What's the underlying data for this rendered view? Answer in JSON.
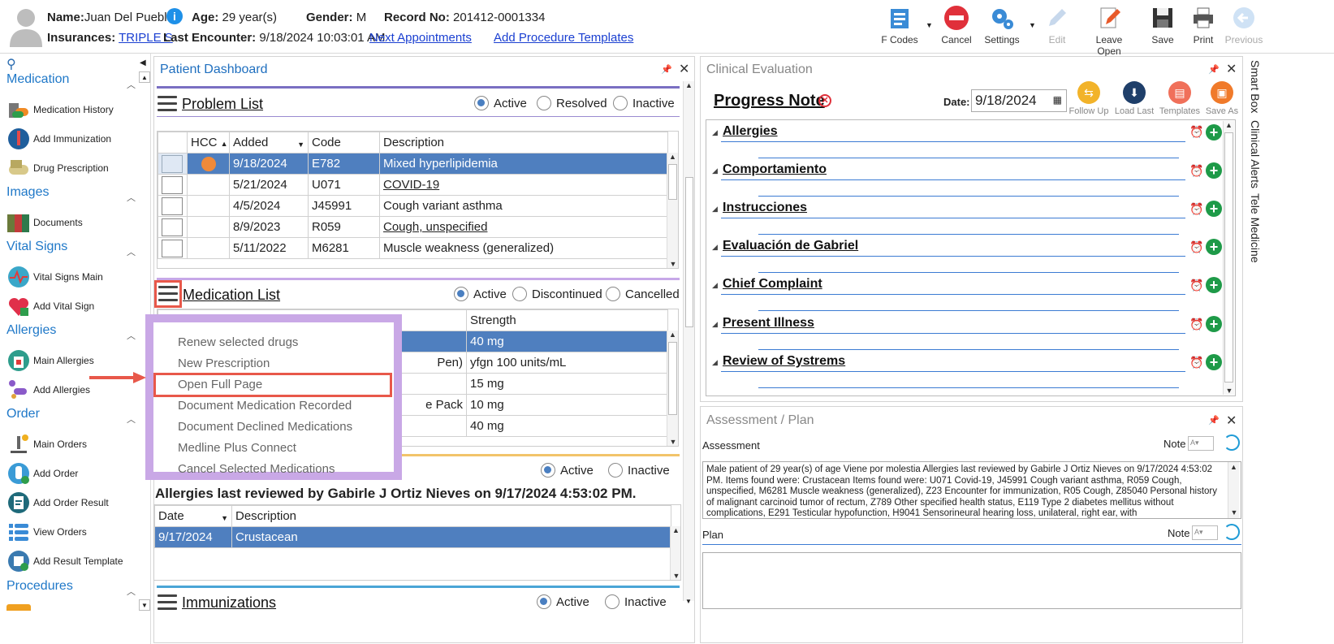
{
  "header": {
    "name_label": "Name:",
    "name": "Juan Del Pueblo",
    "age_label": "Age:",
    "age": "29 year(s)",
    "gender_label": "Gender:",
    "gender": "M",
    "record_label": "Record No:",
    "record": "201412-0001334",
    "insurances_label": "Insurances:",
    "insurance": "TRIPLE S",
    "last_encounter_label": "Last Encounter:",
    "last_encounter": "9/18/2024 10:03:01 AM",
    "next_appointments": "Next Appointments",
    "add_procedure_templates": "Add Procedure Templates"
  },
  "toolbar": {
    "fcodes": "F Codes",
    "cancel": "Cancel",
    "settings": "Settings",
    "edit": "Edit",
    "leave_open": "Leave Open",
    "save": "Save",
    "print": "Print",
    "previous": "Previous"
  },
  "sidebar": {
    "medication": "Medication",
    "medication_history": "Medication History",
    "add_immunization": "Add Immunization",
    "drug_prescription": "Drug Prescription",
    "images": "Images",
    "documents": "Documents",
    "vital_signs": "Vital Signs",
    "vital_signs_main": "Vital Signs Main",
    "add_vital_sign": "Add Vital Sign",
    "allergies": "Allergies",
    "main_allergies": "Main Allergies",
    "add_allergies": "Add Allergies",
    "order": "Order",
    "main_orders": "Main Orders",
    "add_order": "Add Order",
    "add_order_result": "Add Order Result",
    "view_orders": "View Orders",
    "add_result_template": "Add Result Template",
    "procedures": "Procedures"
  },
  "dashboard": {
    "title": "Patient Dashboard",
    "problem_list": {
      "title": "Problem List",
      "radios": [
        "Active",
        "Resolved",
        "Inactive"
      ],
      "columns": [
        "HCC",
        "Added",
        "Code",
        "Description"
      ],
      "rows": [
        {
          "added": "9/18/2024",
          "code": "E782",
          "desc": "Mixed hyperlipidemia"
        },
        {
          "added": "5/21/2024",
          "code": "U071",
          "desc": "COVID-19"
        },
        {
          "added": "4/5/2024",
          "code": "J45991",
          "desc": "Cough variant asthma"
        },
        {
          "added": "8/9/2023",
          "code": "R059",
          "desc": "Cough, unspecified"
        },
        {
          "added": "5/11/2022",
          "code": "M6281",
          "desc": "Muscle weakness (generalized)"
        }
      ]
    },
    "medication_list": {
      "title": "Medication List",
      "radios": [
        "Active",
        "Discontinued",
        "Cancelled"
      ],
      "strength_header": "Strength",
      "rows": [
        {
          "name": "",
          "strength": "40 mg"
        },
        {
          "name": "Pen)",
          "strength": "yfgn 100 units/mL"
        },
        {
          "name": "",
          "strength": "15 mg"
        },
        {
          "name": "e Pack",
          "strength": "10 mg"
        },
        {
          "name": "",
          "strength": "40 mg"
        }
      ]
    },
    "context_menu": {
      "items": [
        "Renew selected drugs",
        "New Prescription",
        "Open Full Page",
        "Document Medication Recorded",
        "Document Declined Medications",
        "Medline Plus Connect",
        "Cancel Selected Medications"
      ]
    },
    "allergies": {
      "radios": [
        "Active",
        "Inactive"
      ],
      "reviewed": "Allergies last reviewed by Gabirle J Ortiz Nieves on 9/17/2024 4:53:02 PM.",
      "columns": [
        "Date",
        "Description"
      ],
      "rows": [
        {
          "date": "9/17/2024",
          "desc": "Crustacean"
        }
      ]
    },
    "immunizations": {
      "title": "Immunizations",
      "radios": [
        "Active",
        "Inactive"
      ]
    }
  },
  "clinical": {
    "title": "Clinical Evaluation",
    "note_title": "Progress Note",
    "date_label": "Date:",
    "date": "9/18/2024",
    "actions": [
      "Follow Up",
      "Load Last",
      "Templates",
      "Save As"
    ],
    "sections": [
      "Allergies",
      "Comportamiento",
      "Instrucciones",
      "Evaluación de Gabriel",
      "Chief Complaint",
      "Present Illness",
      "Review of Systrems"
    ]
  },
  "assessment": {
    "title": "Assessment / Plan",
    "assessment_label": "Assessment",
    "note_label": "Note",
    "text": "Male patient of 29 year(s) of age Viene por molestia     Allergies last reviewed by Gabirle J Ortiz Nieves on 9/17/2024 4:53:02 PM.    Items found were:  Crustacean  Items found were:  U071 Covid-19, J45991 Cough variant asthma, R059 Cough, unspecified, M6281 Muscle weakness (generalized), Z23 Encounter for immunization, R05 Cough, Z85040 Personal history of malignant carcinoid tumor of rectum, Z789 Other specified health status, E119 Type 2 diabetes mellitus without complications, E291 Testicular hypofunction, H9041 Sensorineural hearing loss, unilateral, right ear, with",
    "plan_label": "Plan",
    "plan_note_label": "Note"
  },
  "side_tabs": [
    "Smart Box",
    "Clinical Alerts",
    "Tele Medicine"
  ],
  "colors": {
    "accent": "#1f78c8",
    "selected_row": "#4f7fbf",
    "highlight": "#e8584a",
    "menu_border": "#c9a8e6"
  }
}
